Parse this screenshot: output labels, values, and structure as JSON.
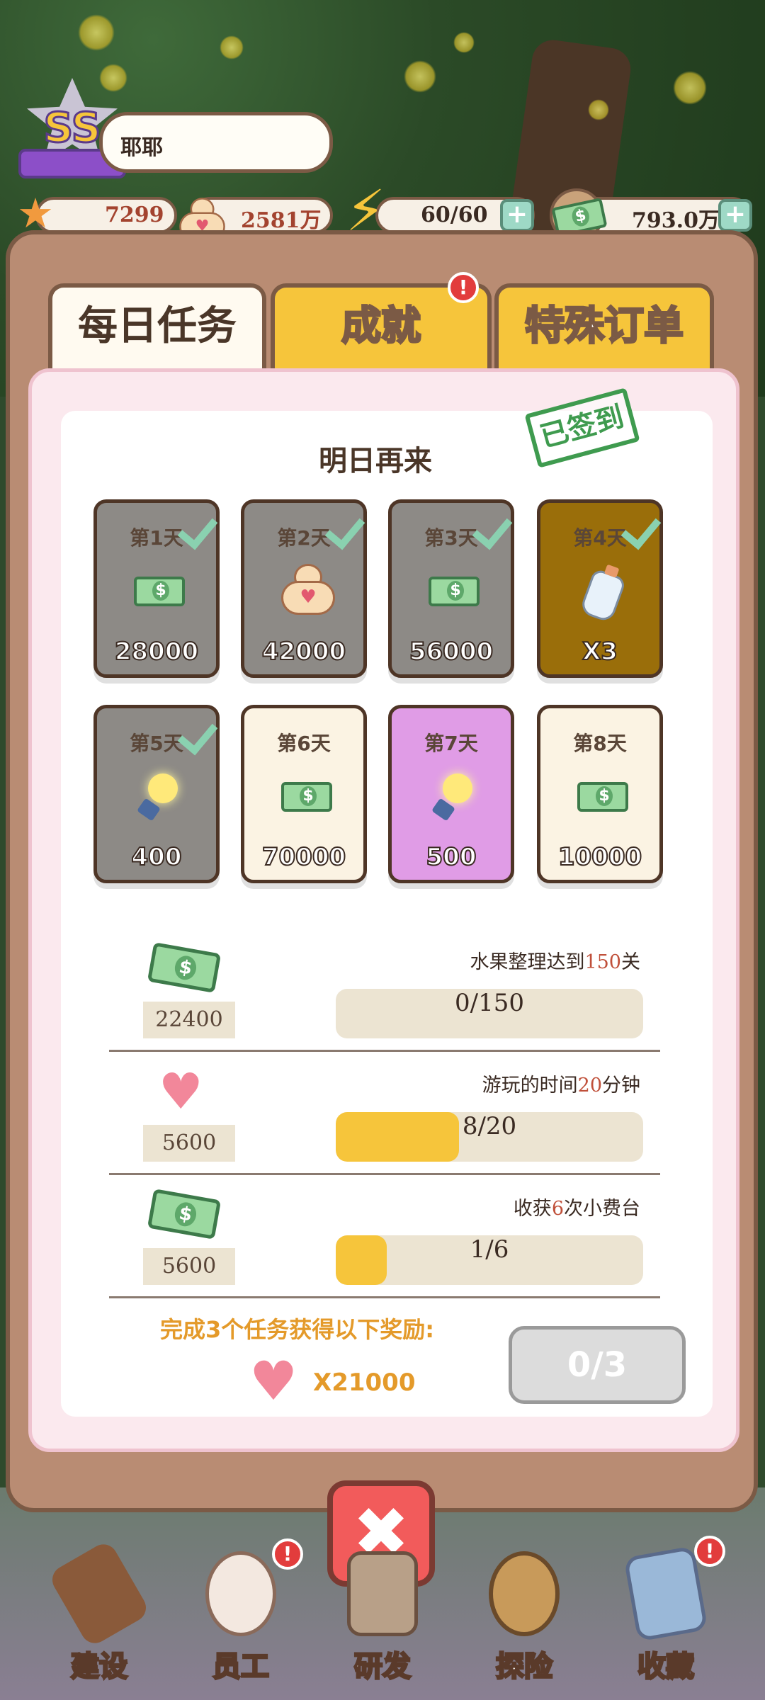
{
  "header": {
    "rank": "SS",
    "player_name": "耶耶",
    "stars": "7299",
    "followers": "2581万",
    "energy": "60/60",
    "cash": "793.0万",
    "plus": "+"
  },
  "tabs": [
    {
      "label": "每日任务",
      "active": true
    },
    {
      "label": "成就",
      "alert": "!"
    },
    {
      "label": "特殊订单"
    }
  ],
  "checkin": {
    "stamp": "已签到",
    "message": "明日再来",
    "days": [
      {
        "label": "第1天",
        "value": "28000",
        "reward": "cash",
        "claimed": true
      },
      {
        "label": "第2天",
        "value": "42000",
        "reward": "fan",
        "claimed": true
      },
      {
        "label": "第3天",
        "value": "56000",
        "reward": "cash",
        "claimed": true
      },
      {
        "label": "第4天",
        "value": "X3",
        "reward": "bottle",
        "claimed": true
      },
      {
        "label": "第5天",
        "value": "400",
        "reward": "bulb",
        "claimed": true
      },
      {
        "label": "第6天",
        "value": "70000",
        "reward": "cash",
        "claimed": false
      },
      {
        "label": "第7天",
        "value": "500",
        "reward": "bulb",
        "claimed": false
      },
      {
        "label": "第8天",
        "value": "10000",
        "reward": "cash",
        "claimed": false
      }
    ]
  },
  "tasks": [
    {
      "reward": "22400",
      "reward_icon": "cash-icon",
      "desc_pre": "水果整理达到",
      "desc_num": "150",
      "desc_post": "关",
      "progress_text": "0/150",
      "progress": 0.0
    },
    {
      "reward": "5600",
      "reward_icon": "heart-icon",
      "desc_pre": "游玩的时间",
      "desc_num": "20",
      "desc_post": "分钟",
      "progress_text": "8/20",
      "progress": 0.4
    },
    {
      "reward": "5600",
      "reward_icon": "cash-icon",
      "desc_pre": "收获",
      "desc_num": "6",
      "desc_post": "次小费台",
      "progress_text": "1/6",
      "progress": 0.1667
    }
  ],
  "bonus": {
    "title": "完成3个任务获得以下奖励:",
    "amount": "X21000",
    "claim_label": "0/3"
  },
  "close_label": "✖",
  "nav": [
    {
      "label": "建设"
    },
    {
      "label": "员工",
      "alert": "!"
    },
    {
      "label": "研发"
    },
    {
      "label": "探险"
    },
    {
      "label": "收藏",
      "alert": "!"
    }
  ],
  "colors": {
    "accent_yellow": "#f6c53b",
    "claimed_card": "#8d8a86",
    "special_card_gold": "#9a6e0a",
    "special_card_purple": "#e09ce6",
    "unclaimed_card": "#fbf3e3",
    "check_green": "#8ad1b0"
  }
}
